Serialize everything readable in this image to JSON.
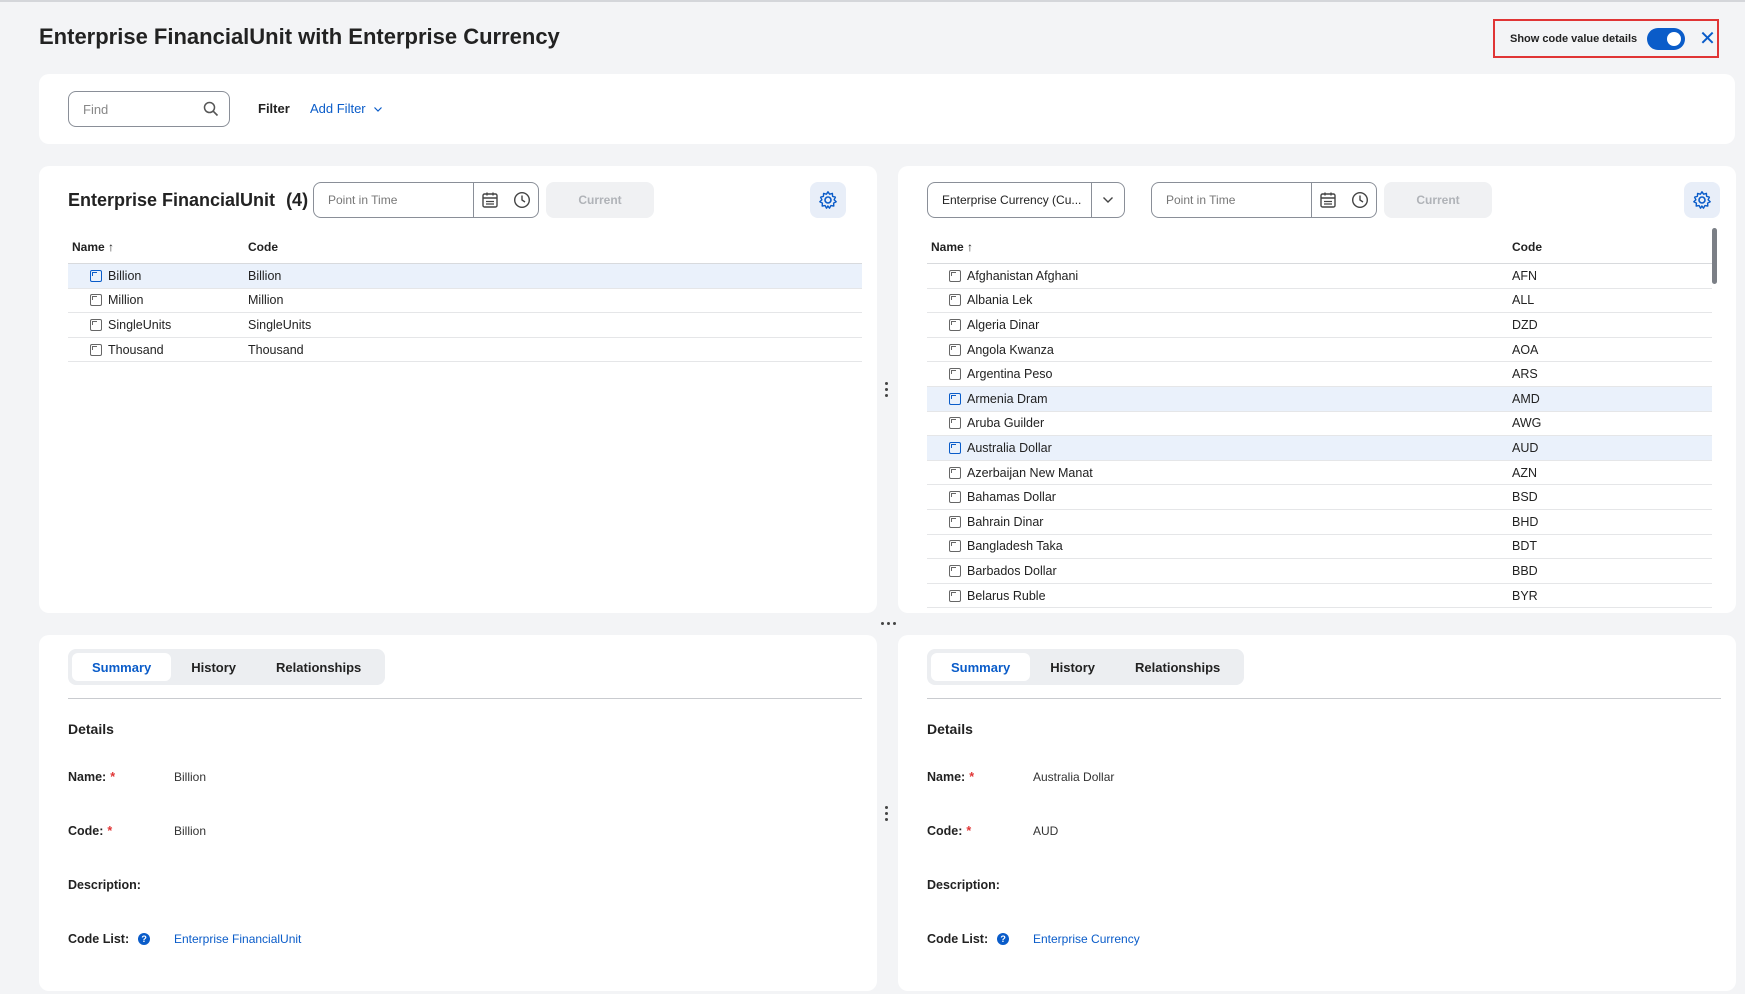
{
  "page": {
    "title": "Enterprise FinancialUnit with Enterprise Currency",
    "show_details_label": "Show code value details",
    "show_details_on": true
  },
  "filter_bar": {
    "find_placeholder": "Find",
    "filter_label": "Filter",
    "add_filter_label": "Add Filter"
  },
  "left_panel": {
    "title": "Enterprise FinancialUnit",
    "count": "(4)",
    "point_in_time_placeholder": "Point in Time",
    "current_label": "Current",
    "columns": [
      "Name ↑",
      "Code"
    ],
    "rows": [
      {
        "name": "Billion",
        "code": "Billion"
      },
      {
        "name": "Million",
        "code": "Million"
      },
      {
        "name": "SingleUnits",
        "code": "SingleUnits"
      },
      {
        "name": "Thousand",
        "code": "Thousand"
      }
    ]
  },
  "right_panel": {
    "selected_list": "Enterprise Currency (Cu...",
    "point_in_time_placeholder": "Point in Time",
    "current_label": "Current",
    "columns": [
      "Name ↑",
      "Code"
    ],
    "rows": [
      {
        "name": "Afghanistan Afghani",
        "code": "AFN"
      },
      {
        "name": "Albania Lek",
        "code": "ALL"
      },
      {
        "name": "Algeria Dinar",
        "code": "DZD"
      },
      {
        "name": "Angola Kwanza",
        "code": "AOA"
      },
      {
        "name": "Argentina Peso",
        "code": "ARS"
      },
      {
        "name": "Armenia Dram",
        "code": "AMD"
      },
      {
        "name": "Aruba Guilder",
        "code": "AWG"
      },
      {
        "name": "Australia Dollar",
        "code": "AUD"
      },
      {
        "name": "Azerbaijan New Manat",
        "code": "AZN"
      },
      {
        "name": "Bahamas Dollar",
        "code": "BSD"
      },
      {
        "name": "Bahrain Dinar",
        "code": "BHD"
      },
      {
        "name": "Bangladesh Taka",
        "code": "BDT"
      },
      {
        "name": "Barbados Dollar",
        "code": "BBD"
      },
      {
        "name": "Belarus Ruble",
        "code": "BYR"
      }
    ]
  },
  "left_detail": {
    "tabs": [
      "Summary",
      "History",
      "Relationships"
    ],
    "heading": "Details",
    "name_label": "Name:",
    "name_value": "Billion",
    "code_label": "Code:",
    "code_value": "Billion",
    "description_label": "Description:",
    "code_list_label": "Code List:",
    "code_list_value": "Enterprise FinancialUnit"
  },
  "right_detail": {
    "tabs": [
      "Summary",
      "History",
      "Relationships"
    ],
    "heading": "Details",
    "name_label": "Name:",
    "name_value": "Australia Dollar",
    "code_label": "Code:",
    "code_value": "AUD",
    "description_label": "Description:",
    "code_list_label": "Code List:",
    "code_list_value": "Enterprise Currency"
  },
  "colors": {
    "accent": "#0a5cc9",
    "highlight_border": "#e03535",
    "selected_row": "#eaf1fb"
  }
}
